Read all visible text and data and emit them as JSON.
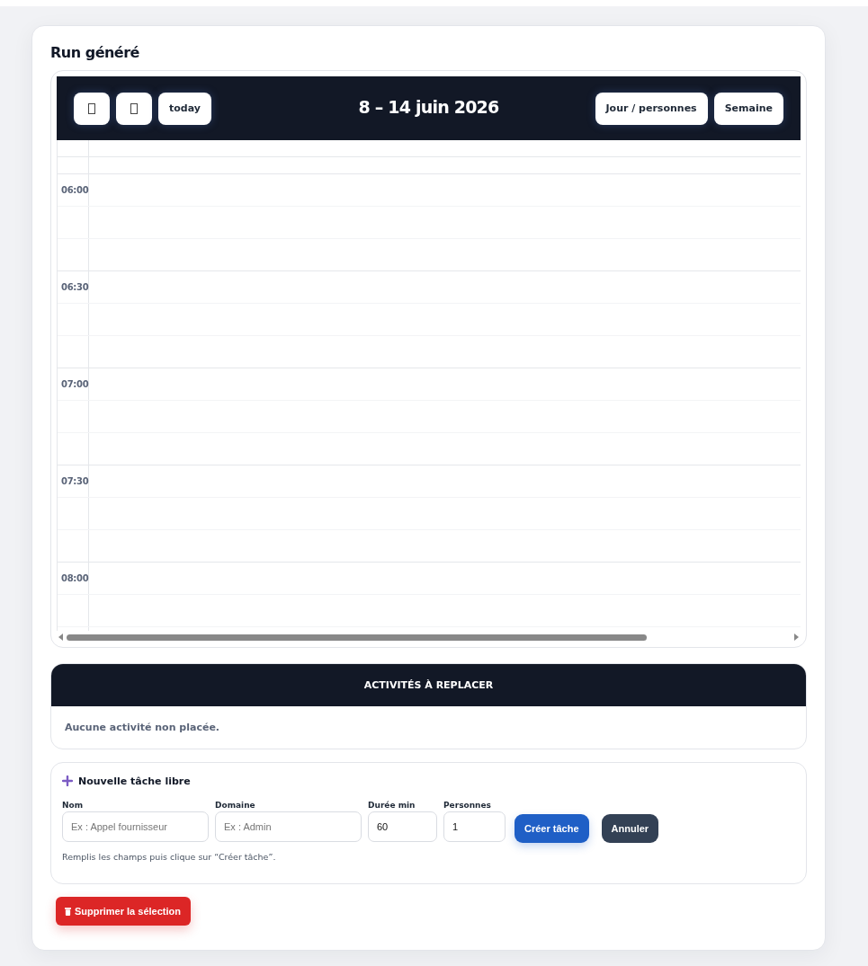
{
  "page": {
    "title": "Run généré"
  },
  "calendar": {
    "today_label": "today",
    "title": "8 – 14 juin 2026",
    "views": [
      {
        "label": "Jour / personnes"
      },
      {
        "label": "Semaine"
      }
    ],
    "time_labels": [
      "06:00",
      "06:30",
      "07:00",
      "07:30",
      "08:00"
    ]
  },
  "unplaced": {
    "title": "ACTIVITÉS À REPLACER",
    "empty_message": "Aucune activité non placée."
  },
  "form": {
    "title": "Nouvelle tâche libre",
    "fields": [
      {
        "label": "Nom",
        "placeholder": "Ex : Appel fournisseur"
      },
      {
        "label": "Domaine",
        "placeholder": "Ex : Admin"
      },
      {
        "label": "Durée min",
        "value": "60"
      },
      {
        "label": "Personnes",
        "value": "1"
      }
    ],
    "buttons": [
      {
        "label": "Créer tâche",
        "kind": "primary"
      },
      {
        "label": "Annuler",
        "kind": "secondary"
      }
    ],
    "hint": "Remplis les champs puis clique sur “Créer tâche”."
  },
  "delete_button": {
    "label": "Supprimer la sélection"
  }
}
